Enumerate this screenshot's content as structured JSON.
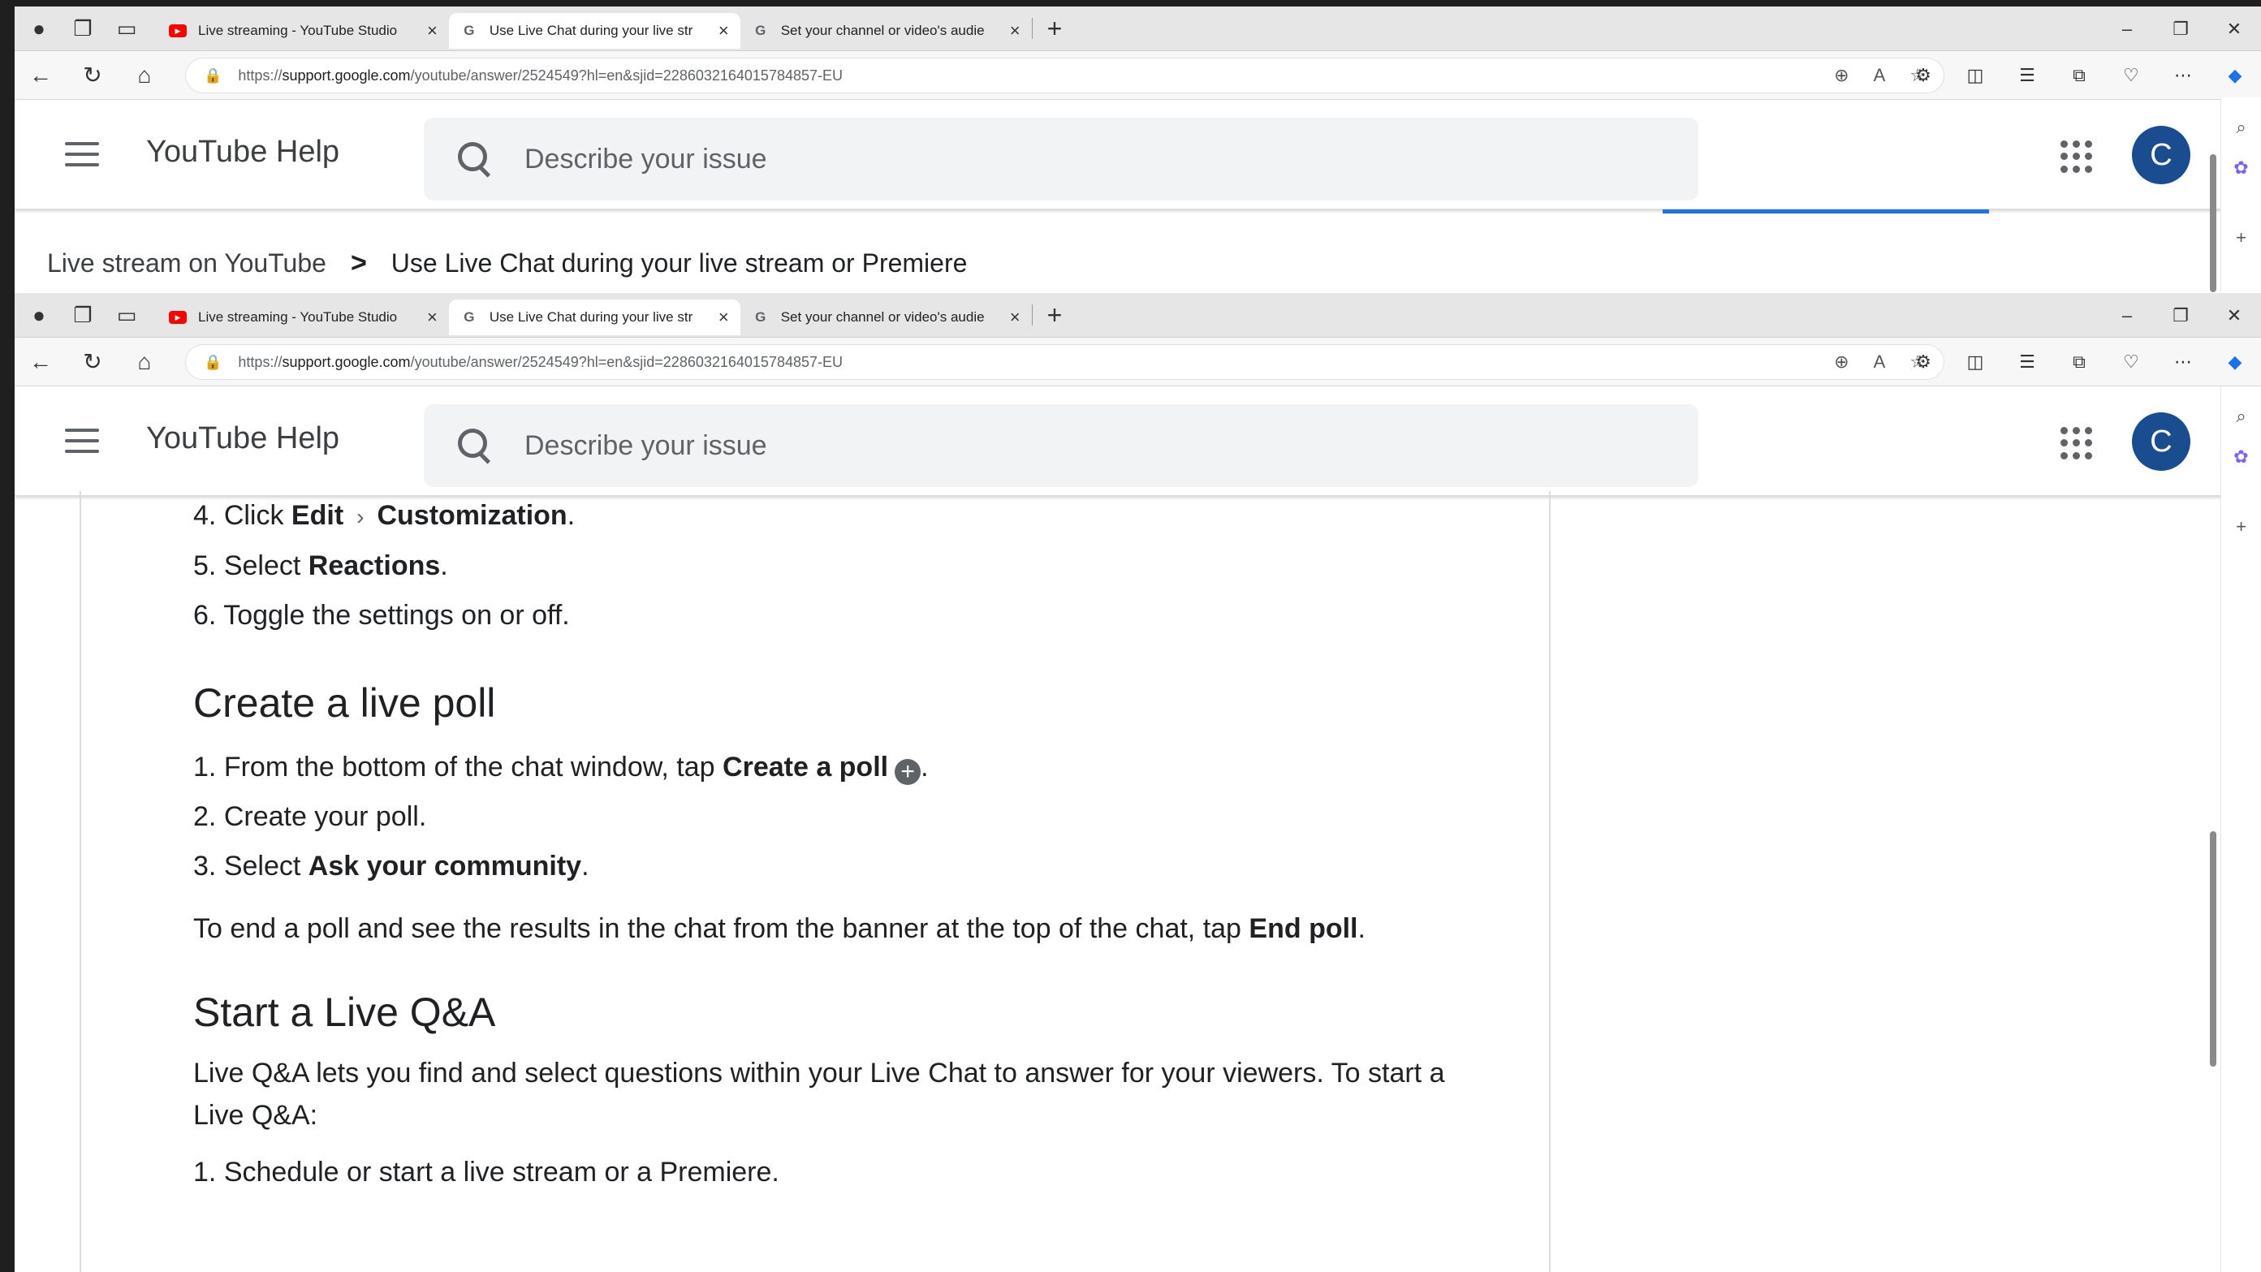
{
  "browser": {
    "tabs": [
      {
        "title": "Live streaming - YouTube Studio",
        "favicon": "youtube-icon",
        "active": false
      },
      {
        "title": "Use Live Chat during your live str",
        "favicon": "google-icon",
        "active": true
      },
      {
        "title": "Set your channel or video's audie",
        "favicon": "google-icon",
        "active": false
      }
    ],
    "url_scheme": "https://",
    "url_host": "support.google.com",
    "url_path": "/youtube/answer/2524549?hl=en&sjid=2286032164015784857-EU",
    "avatar_letter": "C"
  },
  "header": {
    "title": "YouTube Help",
    "search_placeholder": "Describe your issue"
  },
  "breadcrumb": {
    "parent": "Live stream on YouTube",
    "current": "Use Live Chat during your live stream or Premiere"
  },
  "content": {
    "steps_reactions": [
      {
        "num": "4.",
        "pre": "Click ",
        "b1": "Edit",
        "b2": "Customization",
        "post": "."
      },
      {
        "num": "5.",
        "pre": "Select ",
        "b1": "Reactions",
        "post": "."
      },
      {
        "num": "6.",
        "text": "Toggle the settings on or off."
      }
    ],
    "poll_heading": "Create a live poll",
    "poll_steps": [
      {
        "num": "1.",
        "pre": "From the bottom of the chat window, tap ",
        "b1": "Create a poll",
        "post": "."
      },
      {
        "num": "2.",
        "text": "Create your poll."
      },
      {
        "num": "3.",
        "pre": "Select ",
        "b1": "Ask your community",
        "post": "."
      }
    ],
    "poll_para_pre": "To end a poll and see the results in the chat from the banner at the top of the chat, tap ",
    "poll_para_bold": "End poll",
    "poll_para_post": ".",
    "qa_heading": "Start a Live Q&A",
    "qa_para": "Live Q&A lets you find and select questions within your Live Chat to answer for your viewers. To start a Live Q&A:",
    "qa_steps": [
      {
        "num": "1.",
        "text": "Schedule or start a live stream or a Premiere."
      }
    ]
  }
}
